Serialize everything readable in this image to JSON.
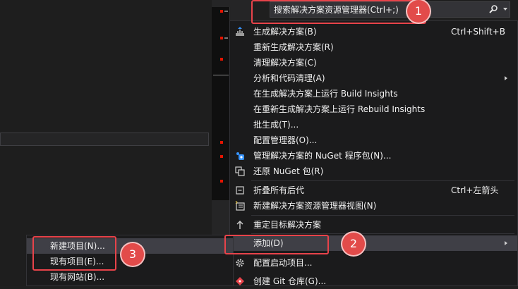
{
  "search": {
    "placeholder": "搜索解决方案资源管理器(Ctrl+;)"
  },
  "context_menu": {
    "items": [
      {
        "label": "生成解决方案(B)",
        "shortcut": "Ctrl+Shift+B",
        "icon": "build-icon"
      },
      {
        "label": "重新生成解决方案(R)"
      },
      {
        "label": "清理解决方案(C)"
      },
      {
        "label": "分析和代码清理(A)",
        "submenu": true
      },
      {
        "label": "在生成解决方案上运行 Build Insights"
      },
      {
        "label": "在重新生成解决方案上运行 Rebuild Insights"
      },
      {
        "label": "批生成(T)..."
      },
      {
        "label": "配置管理器(O)..."
      },
      {
        "label": "管理解决方案的 NuGet 程序包(N)...",
        "icon": "nuget-icon"
      },
      {
        "label": "还原 NuGet 包(R)",
        "icon": "restore-packages-icon"
      },
      {
        "label": "折叠所有后代",
        "shortcut": "Ctrl+左箭头",
        "icon": "collapse-icon"
      },
      {
        "label": "新建解决方案资源管理器视图(N)",
        "icon": "new-view-icon"
      },
      {
        "label": "重定目标解决方案",
        "icon": "retarget-icon"
      },
      {
        "label": "添加(D)",
        "submenu": true,
        "highlighted": true
      },
      {
        "label": "配置启动项目...",
        "icon": "gear-icon"
      },
      {
        "label": "创建 Git 仓库(G)...",
        "icon": "git-icon"
      }
    ]
  },
  "submenu": {
    "items": [
      {
        "label": "新建项目(N)...",
        "highlighted": true
      },
      {
        "label": "现有项目(E)..."
      },
      {
        "label": "现有网站(B)..."
      }
    ]
  },
  "annotations": [
    "1",
    "2",
    "3"
  ],
  "colors": {
    "accent_red": "#e8434a",
    "menu_bg": "#1b1b1c",
    "highlight": "#3f3f46"
  }
}
